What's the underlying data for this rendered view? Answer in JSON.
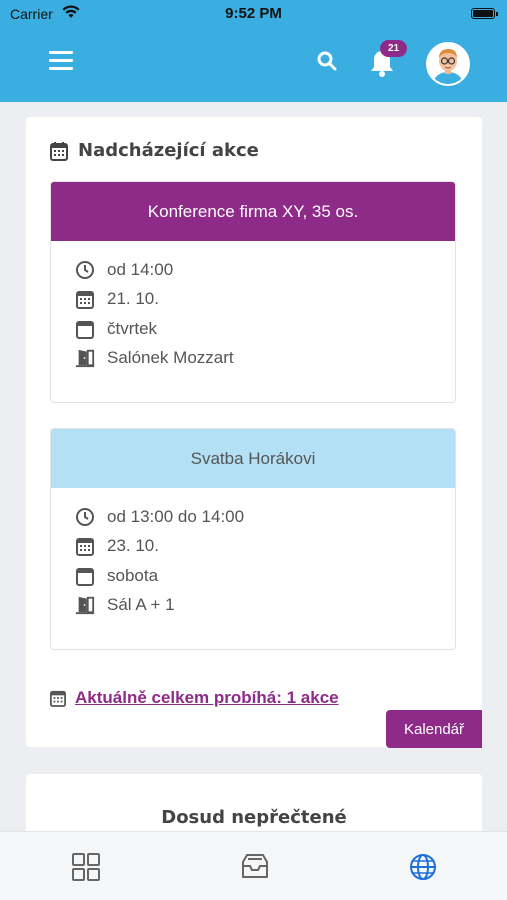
{
  "status_bar": {
    "carrier": "Carrier",
    "time": "9:52 PM"
  },
  "header": {
    "notification_count": "21"
  },
  "upcoming": {
    "title": "Nadcházející akce",
    "events": [
      {
        "name": "Konference firma XY, 35 os.",
        "time": "od 14:00",
        "date": "21. 10.",
        "day": "čtvrtek",
        "room": "Salónek Mozzart"
      },
      {
        "name": "Svatba Horákovi",
        "time": "od 13:00 do 14:00",
        "date": "23. 10.",
        "day": "sobota",
        "room": "Sál A + 1"
      }
    ],
    "summary_link": "Aktuálně celkem probíhá: 1 akce",
    "calendar_button": "Kalendář"
  },
  "unread": {
    "title": "Dosud nepřečtené"
  },
  "colors": {
    "primary": "#3aaee0",
    "accent": "#8e2a88",
    "event2_header": "#b3e0f4"
  }
}
